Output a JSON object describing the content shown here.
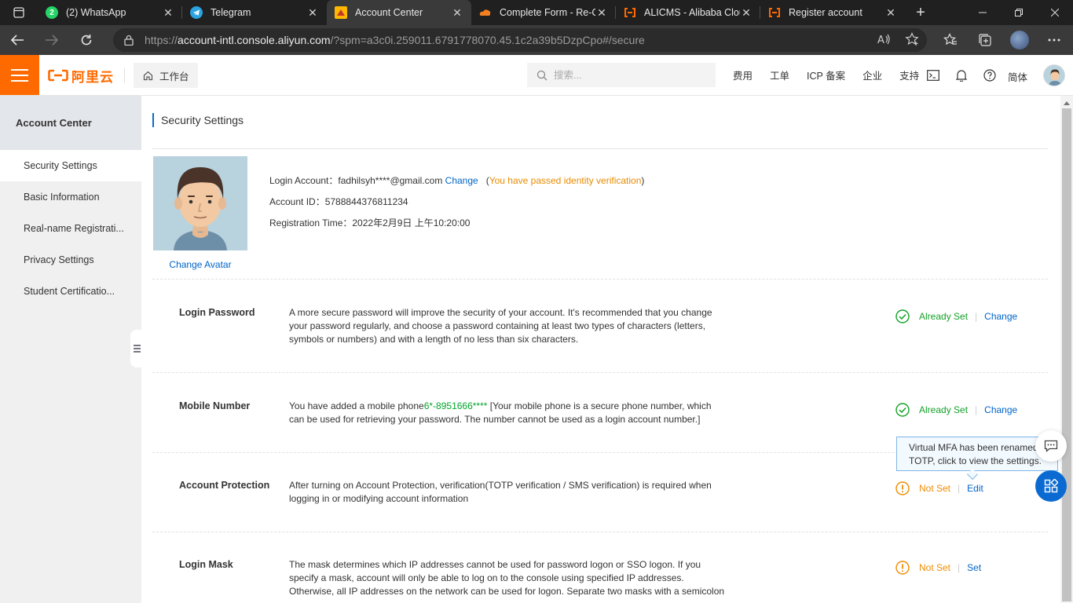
{
  "browser": {
    "tabs": [
      {
        "title": "(2) WhatsApp",
        "icon": "whatsapp-icon",
        "badge": "2",
        "active": false
      },
      {
        "title": "Telegram",
        "icon": "telegram-icon",
        "active": false
      },
      {
        "title": "Account Center",
        "icon": "aliyun-icon",
        "active": true
      },
      {
        "title": "Complete Form - Re-C",
        "icon": "cloud-icon",
        "active": false
      },
      {
        "title": "ALICMS - Alibaba Clou",
        "icon": "alibaba-icon",
        "active": false
      },
      {
        "title": "Register account",
        "icon": "alibaba-icon",
        "active": false
      }
    ],
    "url": {
      "scheme": "https://",
      "host": "account-intl.console.aliyun.com",
      "rest": "/?spm=a3c0i.259011.6791778070.45.1c2a39b5DzpCpo#/secure"
    }
  },
  "topnav": {
    "logo_text": "阿里云",
    "workbench_label": "工作台",
    "search_placeholder": "搜索...",
    "links": [
      "费用",
      "工单",
      "ICP 备案",
      "企业",
      "支持"
    ],
    "language": "简体"
  },
  "sidebar": {
    "title": "Account Center",
    "items": [
      {
        "label": "Security Settings",
        "active": true
      },
      {
        "label": "Basic Information",
        "active": false
      },
      {
        "label": "Real-name Registrati...",
        "active": false
      },
      {
        "label": "Privacy Settings",
        "active": false
      },
      {
        "label": "Student Certificatio...",
        "active": false
      }
    ]
  },
  "page": {
    "title": "Security Settings",
    "change_avatar": "Change Avatar",
    "login_account_label": "Login Account：",
    "login_account_value": "fadhilsyh****@gmail.com",
    "login_account_change": "Change",
    "verified_open": "(",
    "verified_text": "You have passed identity verification",
    "verified_close": ")",
    "account_id_label": "Account ID：",
    "account_id_value": "5788844376811234",
    "registration_label": "Registration Time：",
    "registration_value": "2022年2月9日 上午10:20:00"
  },
  "settings": [
    {
      "title": "Login Password",
      "desc": "A more secure password will improve the security of your account. It's recommended that you change your password regularly, and choose a password containing at least two types of characters (letters, symbols or numbers) and with a length of no less than six characters.",
      "status": "Already Set",
      "action": "Change"
    },
    {
      "title": "Mobile Number",
      "desc_pre": "You have added a mobile phone",
      "desc_phone": "6*-8951666****",
      "desc_post": " [Your mobile phone is a secure phone number, which can be used for retrieving your password. The number cannot be used as a login account number.]",
      "status": "Already Set",
      "action": "Change"
    },
    {
      "title": "Account Protection",
      "desc": "After turning on Account Protection, verification(TOTP verification / SMS verification) is required when logging in or modifying account information",
      "status": "Not Set",
      "action": "Edit"
    },
    {
      "title": "Login Mask",
      "desc": "The mask determines which IP addresses cannot be used for password logon or SSO logon. If you specify a mask, account will only be able to log on to the console using specified IP addresses. Otherwise, all IP addresses on the network can be used for logon. Separate two masks with a semicolon",
      "status": "Not Set",
      "action": "Set"
    }
  ],
  "tooltip": {
    "line1": "Virtual MFA has been renamed",
    "line2": "TOTP, click to view the settings."
  },
  "colors": {
    "brand_orange": "#ff6a00",
    "link_blue": "#0064c8",
    "ok_green": "#14a128",
    "warn_orange": "#f08c00"
  }
}
